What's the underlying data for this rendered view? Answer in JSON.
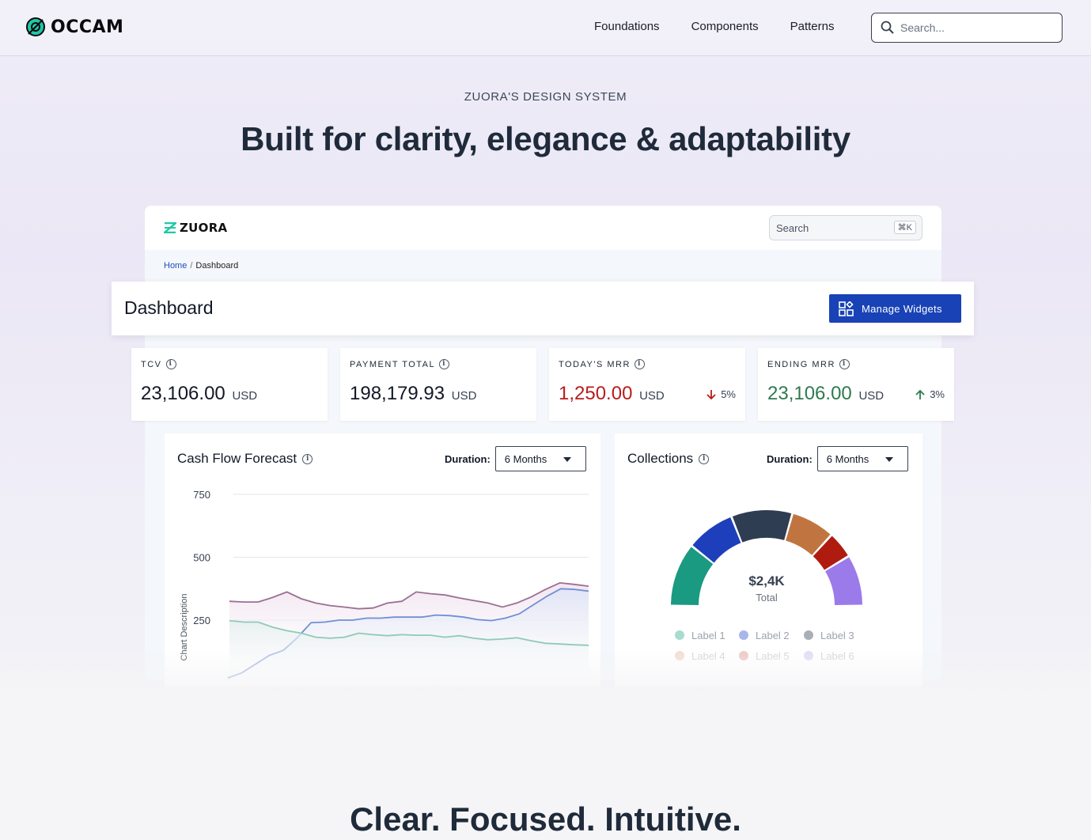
{
  "nav": {
    "brand": "OCCAM",
    "links": [
      "Foundations",
      "Components",
      "Patterns"
    ],
    "search_placeholder": "Search..."
  },
  "hero": {
    "eyebrow": "ZUORA'S DESIGN SYSTEM",
    "title": "Built for clarity, elegance & adaptability"
  },
  "app": {
    "brand": "ZUORA",
    "search_placeholder": "Search",
    "search_shortcut": "⌘K",
    "breadcrumb": {
      "home": "Home",
      "sep": "/",
      "current": "Dashboard"
    },
    "page_title": "Dashboard",
    "manage_button": "Manage Widgets",
    "kpis": [
      {
        "label": "TCV",
        "value": "23,106.00",
        "unit": "USD",
        "color": "#111827"
      },
      {
        "label": "PAYMENT TOTAL",
        "value": "198,179.93",
        "unit": "USD",
        "color": "#111827"
      },
      {
        "label": "TODAY'S MRR",
        "value": "1,250.00",
        "unit": "USD",
        "color": "#b91c1c",
        "delta": "5%",
        "delta_dir": "down"
      },
      {
        "label": "ENDING MRR",
        "value": "23,106.00",
        "unit": "USD",
        "color": "#2f7a4f",
        "delta": "3%",
        "delta_dir": "up"
      }
    ],
    "cashflow": {
      "title": "Cash Flow Forecast",
      "duration_label": "Duration:",
      "duration_value": "6 Months"
    },
    "collections": {
      "title": "Collections",
      "duration_label": "Duration:",
      "duration_value": "6 Months",
      "total_value": "$2,4K",
      "total_label": "Total"
    }
  },
  "chart_data": [
    {
      "type": "line",
      "ylabel": "Chart Description",
      "ylim": [
        0,
        750
      ],
      "yticks": [
        250,
        500,
        750
      ],
      "grid": true,
      "series": [
        {
          "color": "#9b6f93",
          "values": [
            325,
            322,
            322,
            340,
            362,
            335,
            318,
            308,
            302,
            295,
            298,
            318,
            325,
            362,
            355,
            350,
            338,
            328,
            318,
            302,
            318,
            342,
            372,
            398,
            392,
            385
          ]
        },
        {
          "color": "#6f8fd6",
          "values": [
            20,
            40,
            75,
            110,
            130,
            180,
            240,
            242,
            250,
            250,
            258,
            258,
            262,
            262,
            262,
            270,
            268,
            262,
            252,
            248,
            258,
            275,
            310,
            345,
            375,
            372,
            365
          ]
        },
        {
          "color": "#8fcab6",
          "values": [
            248,
            242,
            242,
            222,
            208,
            198,
            182,
            178,
            182,
            198,
            192,
            188,
            192,
            190,
            190,
            182,
            188,
            178,
            172,
            175,
            180,
            168,
            158,
            155,
            152,
            150
          ]
        }
      ]
    },
    {
      "type": "pie",
      "total": "$2,4K",
      "slices": [
        {
          "name": "Label 1",
          "value": 26,
          "color": "#1a9a80"
        },
        {
          "name": "Label 2",
          "value": 20,
          "color": "#1e3fbc"
        },
        {
          "name": "Label 3",
          "value": 25,
          "color": "#2e3d52"
        },
        {
          "name": "Label 4",
          "value": 18,
          "color": "#c07540"
        },
        {
          "name": "Label 5",
          "value": 11,
          "color": "#b01b10"
        },
        {
          "name": "Label 6",
          "value": 21,
          "color": "#9b7bea"
        }
      ]
    }
  ]
}
